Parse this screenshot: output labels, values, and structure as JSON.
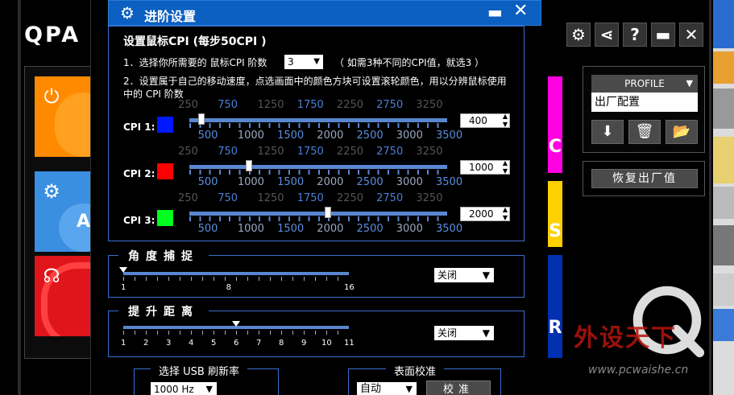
{
  "background_window": {
    "logo": "QPA",
    "profile": {
      "header": "PROFILE",
      "selected": "出厂配置"
    },
    "reset_label": "恢复出厂值",
    "strip_letters": [
      "C",
      "S",
      "R"
    ],
    "tile_letters": [
      "",
      "A"
    ]
  },
  "dialog": {
    "title": "进阶设置",
    "min_label": "▬",
    "close_label": "✕",
    "cpi": {
      "header": "设置鼠标CPI (每步50CPI )",
      "line1_prefix": "1．选择你所需要的 鼠标CPI 阶数",
      "levels_value": "3",
      "line1_suffix": "（ 如需3种不同的CPI值，就选3 ）",
      "line2": "2．设置属于自己的移动速度，点选画面中的颜色方块可设置滚轮颜色，用以分辨鼠标使用中的 CPI 阶数",
      "top_ticks": [
        "250",
        "750",
        "1250",
        "1750",
        "2250",
        "2750",
        "3250"
      ],
      "bottom_ticks": [
        "500",
        "1000",
        "1500",
        "2000",
        "2500",
        "3000",
        "3500"
      ],
      "rows": [
        {
          "label": "CPI 1:",
          "color": "#0018ff",
          "value": "400"
        },
        {
          "label": "CPI 2:",
          "color": "#ff0000",
          "value": "1000"
        },
        {
          "label": "CPI 3:",
          "color": "#00ff1e",
          "value": "2000"
        }
      ]
    },
    "angle": {
      "title": "角度捕捉",
      "ticks": [
        "1",
        "8",
        "16"
      ],
      "value": 1,
      "dropdown": "关闭"
    },
    "lift": {
      "title": "提升距离",
      "ticks": [
        "1",
        "2",
        "3",
        "4",
        "5",
        "6",
        "7",
        "8",
        "9",
        "10",
        "11"
      ],
      "value": 6,
      "dropdown": "关闭"
    },
    "usb": {
      "title": "选择 USB 刷新率",
      "value": "1000 Hz"
    },
    "surface": {
      "title": "表面校准",
      "value": "自动",
      "button": "校准"
    }
  },
  "watermark": {
    "text": "外设天下",
    "url": "www.pcwaishe.cn"
  }
}
